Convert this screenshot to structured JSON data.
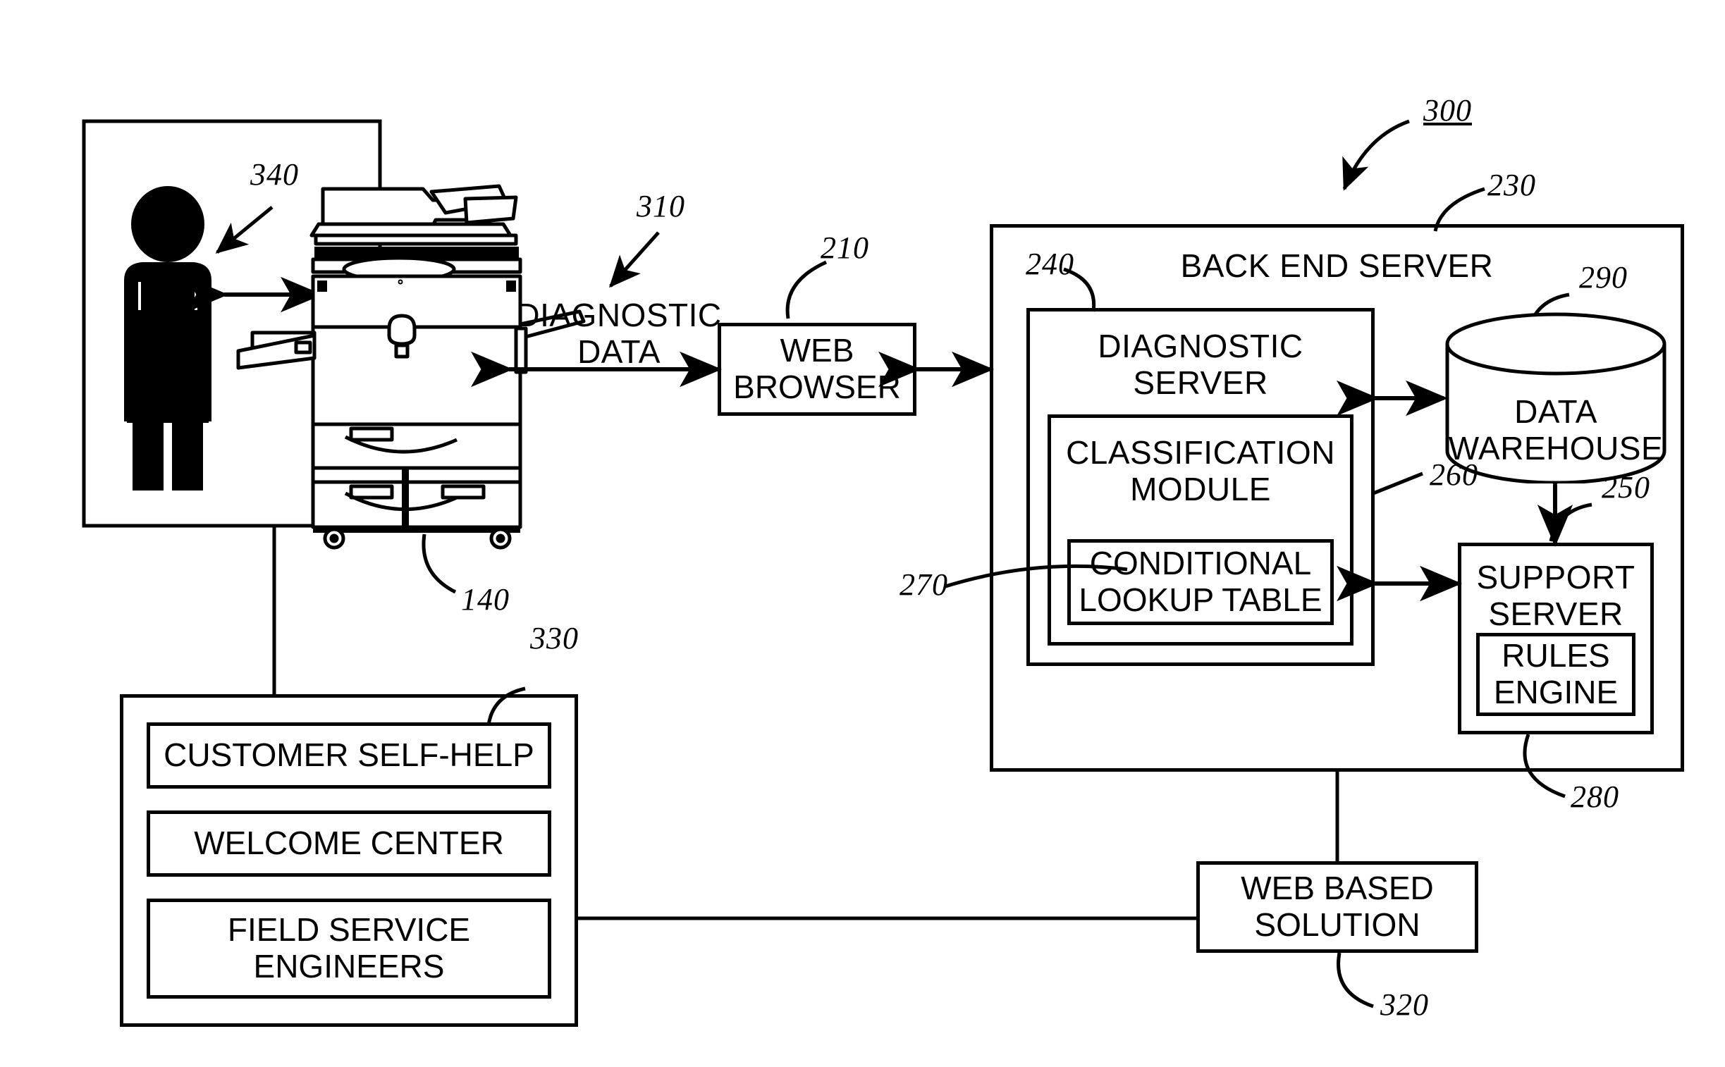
{
  "figure": {
    "title": "System architecture diagram",
    "figure_ref": "300"
  },
  "blocks": {
    "user_scene": {
      "ref": "340",
      "label": ""
    },
    "printer": {
      "ref": "140",
      "label": ""
    },
    "diagnostic_data": {
      "ref": "310",
      "label": "DIAGNOSTIC\nDATA"
    },
    "web_browser": {
      "ref": "210",
      "label": "WEB\nBROWSER"
    },
    "back_end_server": {
      "ref": "230",
      "label": "BACK END SERVER"
    },
    "diagnostic_server": {
      "ref": "240",
      "label": "DIAGNOSTIC\nSERVER"
    },
    "classification_module": {
      "ref": "260",
      "label": "CLASSIFICATION\nMODULE"
    },
    "conditional_lookup_table": {
      "ref": "270",
      "label": "CONDITIONAL\nLOOKUP TABLE"
    },
    "data_warehouse": {
      "ref": "290",
      "label": "DATA\nWAREHOUSE"
    },
    "support_server": {
      "ref": "250",
      "label": "SUPPORT\nSERVER"
    },
    "rules_engine": {
      "ref": "280",
      "label": "RULES\nENGINE"
    },
    "support_group": {
      "ref": "330",
      "label": ""
    },
    "customer_self_help": {
      "label": "CUSTOMER SELF-HELP"
    },
    "welcome_center": {
      "label": "WELCOME CENTER"
    },
    "field_service_engineers": {
      "label": "FIELD SERVICE\nENGINEERS"
    },
    "web_based_solution": {
      "ref": "320",
      "label": "WEB BASED\nSOLUTION"
    }
  },
  "colors": {
    "line": "#000000",
    "background": "#ffffff"
  }
}
